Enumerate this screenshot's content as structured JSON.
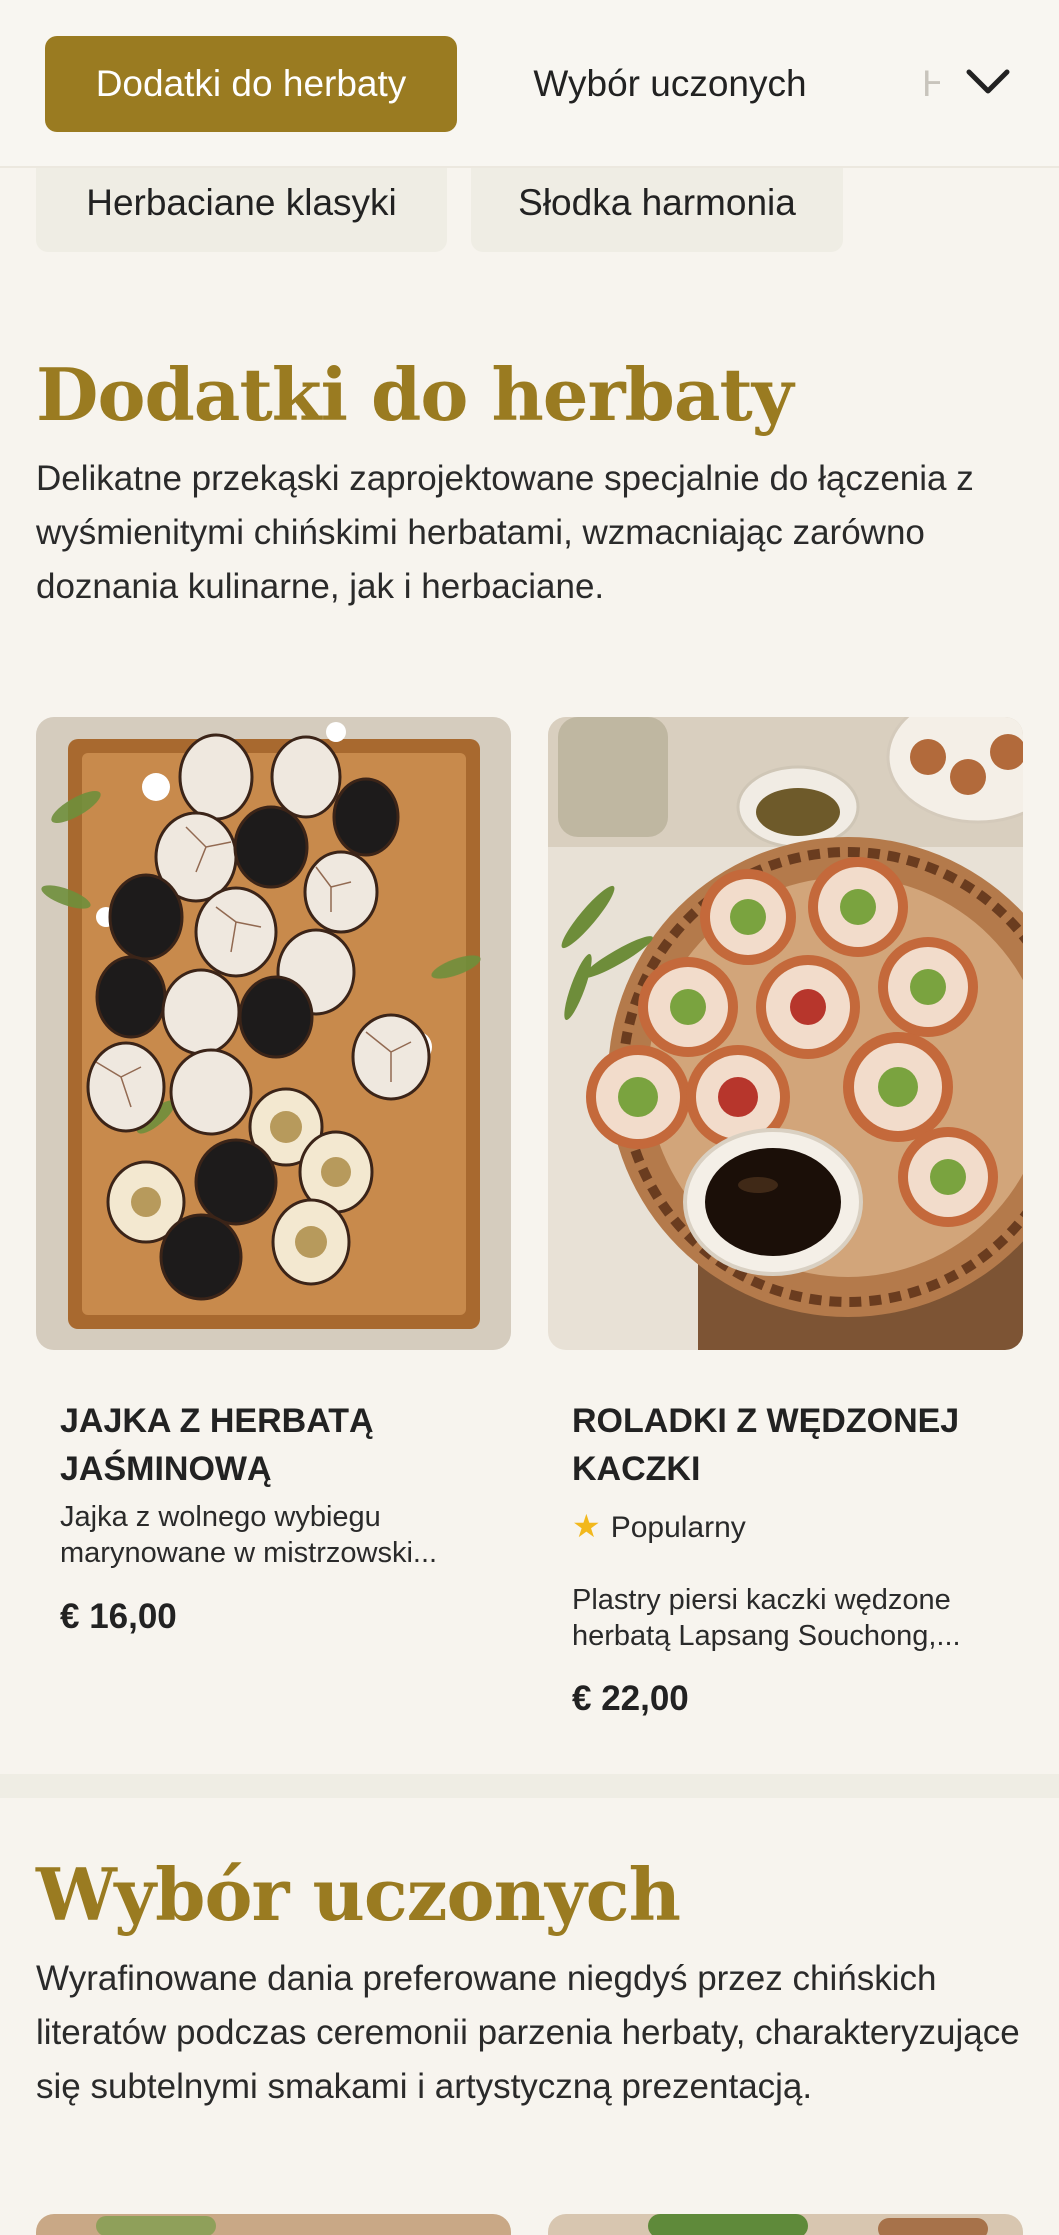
{
  "nav": {
    "tabs": [
      {
        "label": "Dodatki do herbaty",
        "active": true
      },
      {
        "label": "Wybór uczonych",
        "active": false
      },
      {
        "label": "H",
        "active": false
      }
    ],
    "expand_icon": "chevron-down-icon"
  },
  "subnav": {
    "pills": [
      "Herbaciane klasyki",
      "Słodka harmonia"
    ]
  },
  "sections": [
    {
      "title": "Dodatki do herbaty",
      "description": "Delikatne przekąski zaprojektowane specjalnie do łączenia z wyśmienitymi chińskimi herbatami, wzmacniając zarówno doznania kulinarne, jak i herbaciane.",
      "items": [
        {
          "name": "JAJKA Z HERBATĄ JAŚMINOWĄ",
          "description": "Jajka z wolnego wybiegu marynowane w mistrzowski...",
          "price": "€ 16,00",
          "badge": ""
        },
        {
          "name": "ROLADKI Z WĘDZONEJ KACZKI",
          "description": "Plastry piersi kaczki wędzone herbatą Lapsang Souchong,...",
          "price": "€ 22,00",
          "badge": "Popularny"
        }
      ]
    },
    {
      "title": "Wybór uczonych",
      "description": "Wyrafinowane dania preferowane niegdyś przez chińskich literatów podczas ceremonii parzenia herbaty, charakteryzujące się subtelnymi smakami i artystyczną prezentacją."
    }
  ],
  "colors": {
    "accent": "#9a7b21",
    "background": "#f7f4ee",
    "pill_bg": "#efede4",
    "star": "#f2b81d"
  }
}
